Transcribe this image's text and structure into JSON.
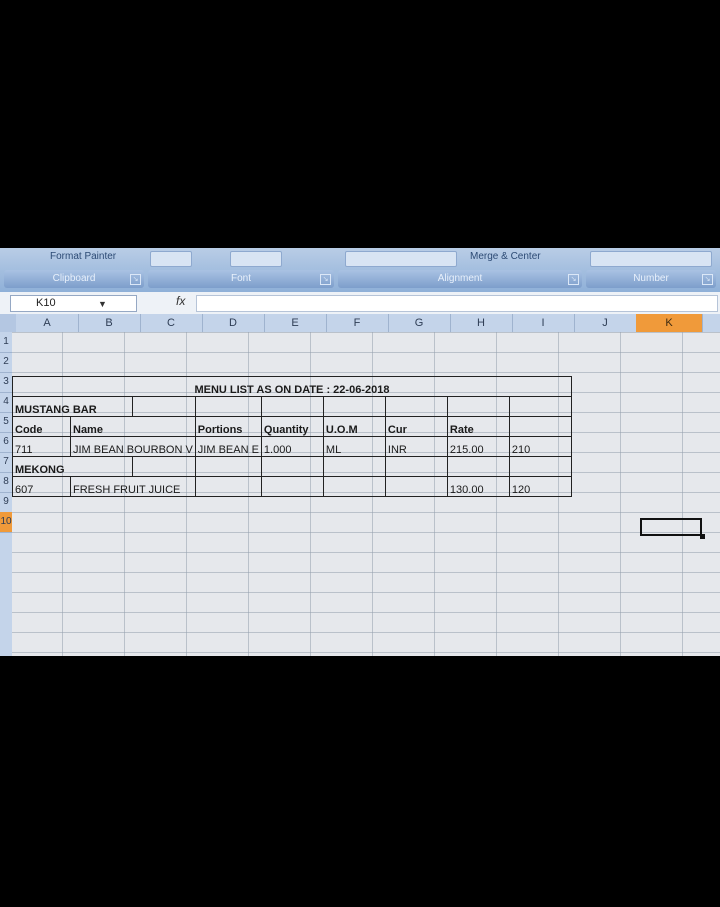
{
  "ribbon": {
    "format_painter": "Format Painter",
    "merge_center": "Merge & Center",
    "groups": {
      "clipboard": "Clipboard",
      "font": "Font",
      "alignment": "Alignment",
      "number": "Number"
    }
  },
  "formula_bar": {
    "name_box": "K10",
    "fx": "fx",
    "value": ""
  },
  "columns": [
    "A",
    "B",
    "C",
    "D",
    "E",
    "F",
    "G",
    "H",
    "I",
    "J",
    "K"
  ],
  "active_column": "K",
  "rows": [
    "1",
    "2",
    "3",
    "4",
    "5",
    "6",
    "7",
    "8",
    "9",
    "10"
  ],
  "sheet": {
    "title": "MENU LIST AS ON DATE : 22-06-2018",
    "section1": "MUSTANG BAR",
    "headers": {
      "code": "Code",
      "name": "Name",
      "portions": "Portions",
      "quantity": "Quantity",
      "uom": "U.O.M",
      "cur": "Cur",
      "rate": "Rate"
    },
    "item1": {
      "code": "711",
      "name": "JIM BEAN BOURBON V",
      "portions": "JIM BEAN E",
      "quantity": "1.000",
      "uom": "ML",
      "cur": "INR",
      "rate": "215.00",
      "rate2": "210"
    },
    "section2": "MEKONG",
    "item2": {
      "code": "607",
      "name": "FRESH FRUIT JUICE",
      "rate": "130.00",
      "rate2": "120"
    }
  }
}
